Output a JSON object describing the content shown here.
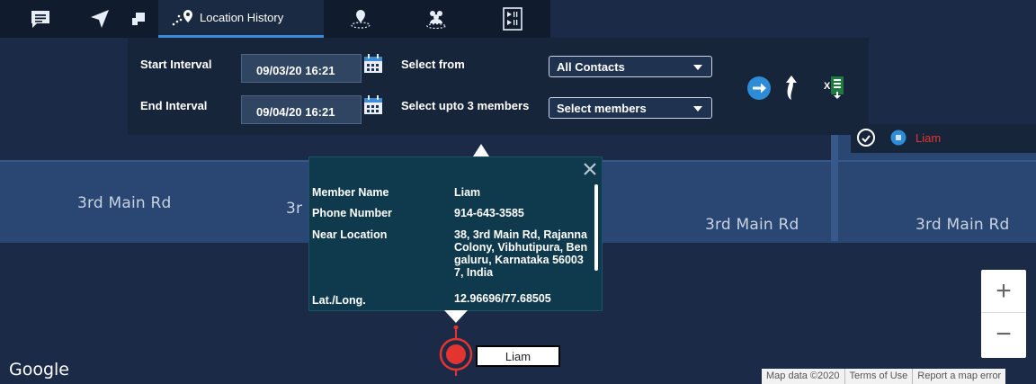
{
  "toolbar": {
    "active_tab_label": "Location History"
  },
  "filter": {
    "start_label": "Start Interval",
    "start_value": "09/03/20 16:21",
    "end_label": "End Interval",
    "end_value": "09/04/20 16:21",
    "select_from_label": "Select from",
    "select_from_value": "All Contacts",
    "members_label": "Select upto 3 members",
    "members_value": "Select members"
  },
  "legend": {
    "member": "Liam",
    "member_color": "#e3342f"
  },
  "map": {
    "roads": [
      "3rd Main Rd",
      "3rd Main Rd",
      "3rd Main Rd",
      "3rd Main Rd"
    ],
    "road_partial": "3r",
    "marker_label": "Liam",
    "google": "Google",
    "zoom_in": "+",
    "zoom_out": "−"
  },
  "popup": {
    "rows": [
      {
        "key": "Member Name",
        "value": "Liam"
      },
      {
        "key": "Phone Number",
        "value": "914-643-3585"
      },
      {
        "key": "Near Location",
        "value": "38, 3rd Main Rd, Rajanna Colony, Vibhutipura, Bengaluru, Karnataka 560037, India"
      },
      {
        "key": "Lat./Long.",
        "value": "12.96696/77.68505"
      }
    ]
  },
  "credits": [
    "Map data ©2020",
    "Terms of Use",
    "Report a map error"
  ],
  "colors": {
    "accent": "#2e8bd6",
    "panel": "#17253b",
    "marker": "#e3342f"
  }
}
